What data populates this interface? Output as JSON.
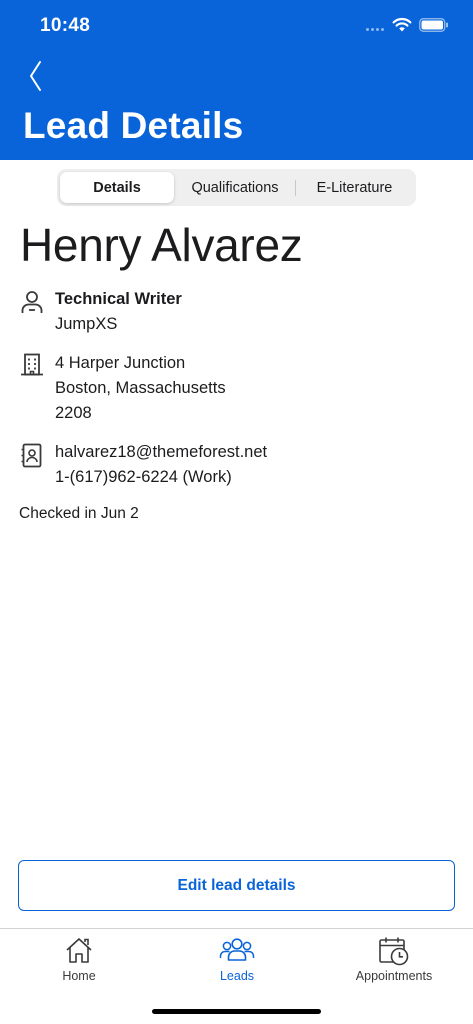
{
  "status": {
    "time": "10:48"
  },
  "header": {
    "title": "Lead Details",
    "back_icon": "chevron-left-icon"
  },
  "tabs": [
    {
      "label": "Details",
      "selected": true
    },
    {
      "label": "Qualifications",
      "selected": false
    },
    {
      "label": "E-Literature",
      "selected": false
    }
  ],
  "lead": {
    "name": "Henry Alvarez",
    "job_title": "Technical Writer",
    "company": "JumpXS",
    "address_line1": "4 Harper Junction",
    "address_line2": "Boston, Massachusetts",
    "address_line3": "2208",
    "email": "halvarez18@themeforest.net",
    "phone": "1-(617)962-6224 (Work)",
    "checked_in": "Checked in Jun 2"
  },
  "actions": {
    "edit_label": "Edit lead details"
  },
  "tab_bar": [
    {
      "label": "Home",
      "icon": "home-icon",
      "active": false
    },
    {
      "label": "Leads",
      "icon": "people-icon",
      "active": true
    },
    {
      "label": "Appointments",
      "icon": "calendar-clock-icon",
      "active": false
    }
  ],
  "colors": {
    "brand": "#0a64d9",
    "text": "#1c1c1e",
    "segment_bg": "#efeff0"
  }
}
